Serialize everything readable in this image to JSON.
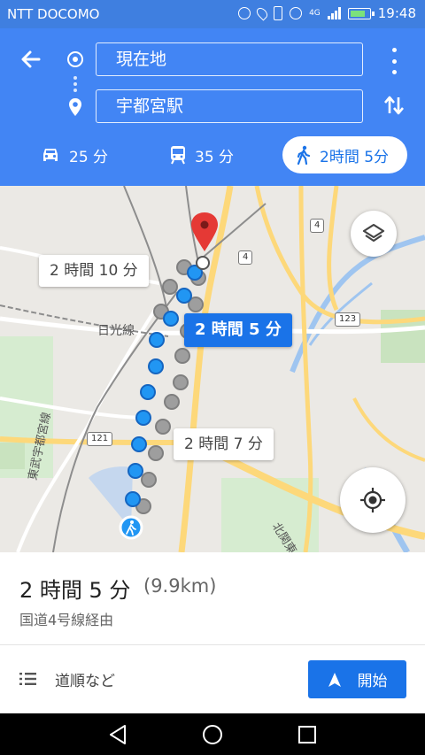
{
  "status_bar": {
    "carrier": "NTT DOCOMO",
    "network": "4G",
    "time": "19:48"
  },
  "directions": {
    "origin": "現在地",
    "destination": "宇都宮駅",
    "modes": [
      {
        "name": "car",
        "time": "25 分",
        "icon": "car-icon"
      },
      {
        "name": "transit",
        "time": "35 分",
        "icon": "train-icon"
      },
      {
        "name": "walk",
        "time": "2時間 5分",
        "icon": "walk-icon",
        "selected": true
      }
    ]
  },
  "map": {
    "route_labels": {
      "main": "2 時間 5 分",
      "alt1": "2 時間 10 分",
      "alt2": "2 時間 7 分"
    },
    "place_labels": {
      "line1": "日光線",
      "line2": "東武宇都宮線",
      "road1": "北関東自動車道"
    },
    "road_numbers": [
      "4",
      "4",
      "123",
      "121"
    ],
    "colors": {
      "route": "#2196f3",
      "alt_route": "#9e9e9e",
      "pin": "#e53935"
    }
  },
  "summary": {
    "duration": "2 時間 5 分",
    "distance": "(9.9km)",
    "via": "国道4号線経由",
    "steps_label": "道順など",
    "start_label": "開始"
  }
}
